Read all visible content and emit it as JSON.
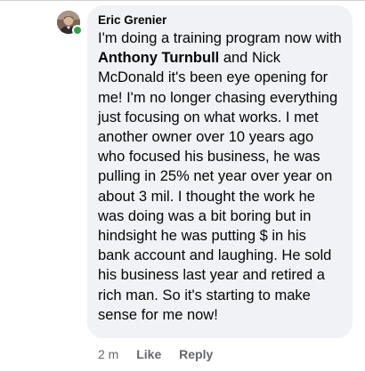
{
  "comment": {
    "author": "Eric Grenier",
    "text_before_mention": "I'm doing a training program now with ",
    "mention": "Anthony Turnbull",
    "text_after_mention": " and Nick McDonald it's been eye opening for me! I'm no longer chasing everything just focusing on what works. I met another owner over 10 years ago who focused his business, he was pulling in 25% net year over year on about 3 mil. I thought the work he was doing was a bit boring but in hindsight he was putting $ in his bank account and laughing. He sold his business last year and retired a rich man. So it's starting to make sense for me now!",
    "time": "2 m",
    "like_label": "Like",
    "reply_label": "Reply"
  },
  "colors": {
    "bubble_bg": "#f0f2f5",
    "text": "#050505",
    "secondary_text": "#65676b",
    "online_status": "#31a24c"
  },
  "icons": {
    "avatar": "profile-photo",
    "status": "online-dot"
  }
}
